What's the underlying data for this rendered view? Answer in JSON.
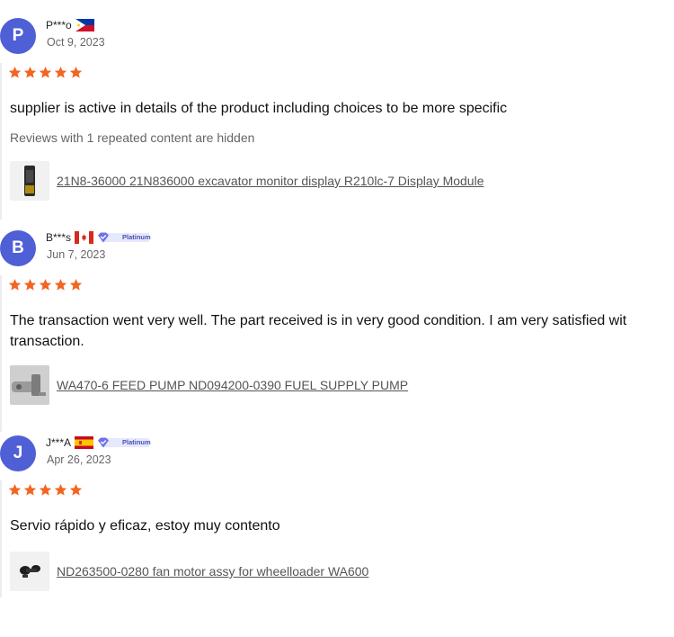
{
  "reviews": [
    {
      "avatar_letter": "P",
      "name": "P***o",
      "flag": "philippines-flag-icon",
      "badge": "",
      "date": "Oct 9, 2023",
      "rating": 5,
      "text_lines": [
        "supplier is active in details of the product including choices to be more specific"
      ],
      "note": "Reviews with 1 repeated content are hidden",
      "product": "21N8-36000 21N836000 excavator monitor display R210lc-7 Display Module"
    },
    {
      "avatar_letter": "B",
      "name": "B***s",
      "flag": "canada-flag-icon",
      "badge": "Platinum",
      "date": "Jun 7, 2023",
      "rating": 5,
      "text_lines": [
        "The transaction went very well. The part received is in very good condition. I am very satisfied wit",
        "transaction."
      ],
      "note": "",
      "product": "WA470-6 FEED PUMP ND094200-0390 FUEL SUPPLY PUMP"
    },
    {
      "avatar_letter": "J",
      "name": "J***A",
      "flag": "spain-flag-icon",
      "badge": "Platinum",
      "date": "Apr 26, 2023",
      "rating": 5,
      "text_lines": [
        "Servio rápido y eficaz, estoy muy contento"
      ],
      "note": "",
      "product": "ND263500-0280 fan motor assy for wheelloader WA600"
    }
  ],
  "colors": {
    "avatar": "#4f5fd6",
    "star": "#f26522",
    "badge": "#6b73e8"
  }
}
